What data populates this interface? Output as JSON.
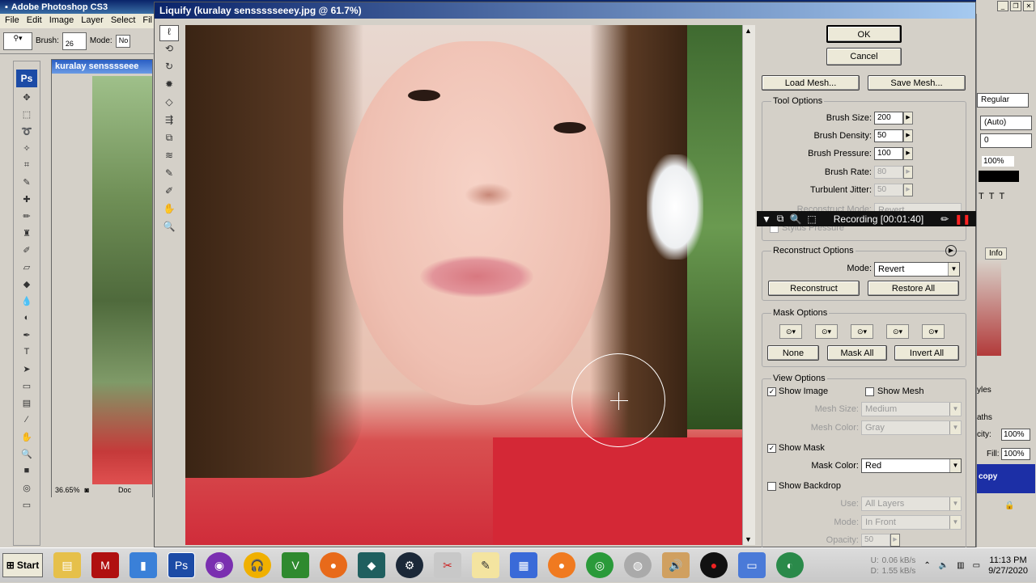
{
  "ps": {
    "title": "Adobe Photoshop CS3",
    "menu": [
      "File",
      "Edit",
      "Image",
      "Layer",
      "Select",
      "Fil"
    ],
    "opt_brush_label": "Brush:",
    "opt_brush_size": "26",
    "opt_mode_label": "Mode:",
    "opt_mode_value": "No",
    "logo": "Ps"
  },
  "doc": {
    "title": "kuralay sensssseee",
    "zoom": "36.65%",
    "status": "Doc"
  },
  "liquify": {
    "title": "Liquify (kuralay senssssseeey.jpg @ 61.7%)",
    "ok": "OK",
    "cancel": "Cancel",
    "load_mesh": "Load Mesh...",
    "save_mesh": "Save Mesh...",
    "tool_options": "Tool Options",
    "brush_size_label": "Brush Size:",
    "brush_size": "200",
    "brush_density_label": "Brush Density:",
    "brush_density": "50",
    "brush_pressure_label": "Brush Pressure:",
    "brush_pressure": "100",
    "brush_rate_label": "Brush Rate:",
    "brush_rate": "80",
    "turbulent_label": "Turbulent Jitter:",
    "turbulent": "50",
    "reconstruct_mode_label": "Reconstruct Mode:",
    "reconstruct_mode": "Revert",
    "stylus_label": "Stylus Pressure",
    "reconstruct_options": "Reconstruct Options",
    "mode_label": "Mode:",
    "mode_value": "Revert",
    "reconstruct_btn": "Reconstruct",
    "restore_all_btn": "Restore All",
    "mask_options": "Mask Options",
    "none_btn": "None",
    "mask_all_btn": "Mask All",
    "invert_all_btn": "Invert All",
    "view_options": "View Options",
    "show_image": "Show Image",
    "show_mesh": "Show Mesh",
    "mesh_size_label": "Mesh Size:",
    "mesh_size": "Medium",
    "mesh_color_label": "Mesh Color:",
    "mesh_color": "Gray",
    "show_mask": "Show Mask",
    "mask_color_label": "Mask Color:",
    "mask_color": "Red",
    "show_backdrop": "Show Backdrop",
    "use_label": "Use:",
    "use_value": "All Layers",
    "bd_mode_label": "Mode:",
    "bd_mode_value": "In Front",
    "opacity_label": "Opacity:",
    "opacity_value": "50"
  },
  "recording": {
    "text": "Recording [00:01:40]"
  },
  "rpanel": {
    "font_style": "Regular",
    "leading": "(Auto)",
    "tracking": "0",
    "scale": "100%",
    "tab_info": "Info",
    "tab_styles": "yles",
    "tab_paths": "aths",
    "opacity_label": "city:",
    "opacity": "100%",
    "fill_label": "Fill:",
    "fill": "100%",
    "copy": "copy"
  },
  "taskbar": {
    "start": "Start",
    "time": "11:13 PM",
    "date": "9/27/2020",
    "net_up": "0.06 kB/s",
    "net_down": "1.55 kB/s",
    "u": "U:",
    "d": "D:"
  }
}
